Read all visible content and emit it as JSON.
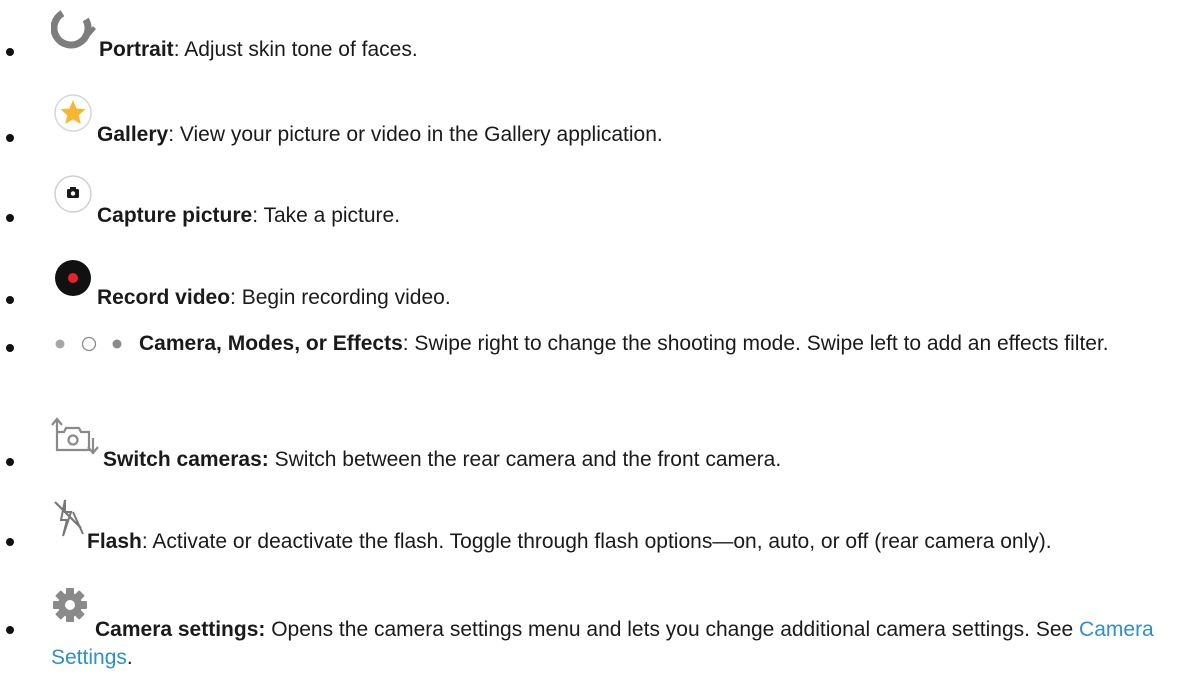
{
  "items": [
    {
      "icon": "portrait-icon",
      "term": "Portrait",
      "text": ": Adjust skin tone of faces."
    },
    {
      "icon": "gallery-icon",
      "term": "Gallery",
      "text": ": View your picture or video in the Gallery application."
    },
    {
      "icon": "capture-picture-icon",
      "term": "Capture picture",
      "text": ": Take a picture."
    },
    {
      "icon": "record-video-icon",
      "term": "Record video",
      "text": ": Begin recording video."
    },
    {
      "icon": "mode-dots-icon",
      "term": "Camera, Modes, or Effects",
      "text": ": Swipe right to change the shooting mode. Swipe left to add an effects filter."
    },
    {
      "icon": "switch-camera-icon",
      "term": "Switch cameras:",
      "text": " Switch between the rear camera and the front camera."
    },
    {
      "icon": "flash-off-icon",
      "term": "Flash",
      "text": ": Activate or deactivate the flash. Toggle through flash options—on, auto, or off (rear camera only)."
    },
    {
      "icon": "gear-icon",
      "term": "Camera settings:",
      "text": " Opens the camera settings menu and lets you change additional camera settings. See ",
      "link": "Camera Settings",
      "tail": "."
    }
  ],
  "colors": {
    "text": "#1a1a1a",
    "link": "#2f8fc7",
    "gallery_star": "#f6b733",
    "record_dot": "#e8222a",
    "icon_gray": "#8a8a8a"
  }
}
